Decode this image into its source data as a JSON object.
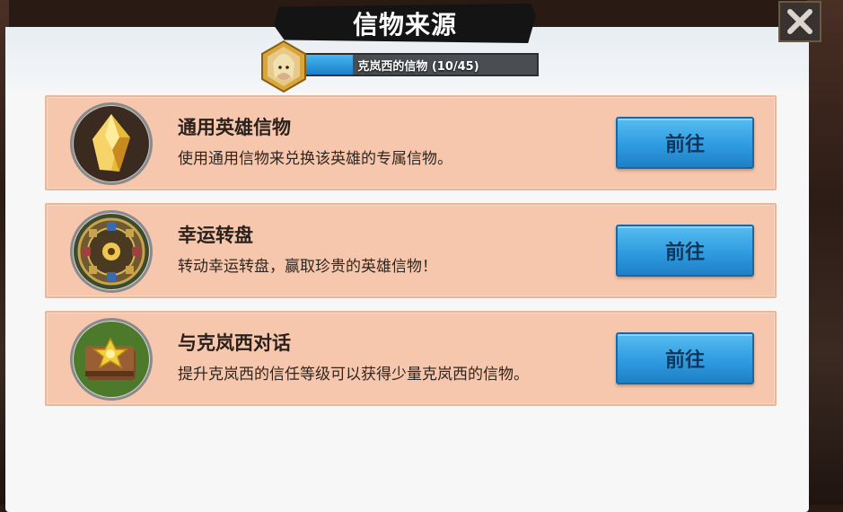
{
  "title": "信物来源",
  "progress": {
    "label": "克岚西的信物 (10/45)",
    "current": 10,
    "total": 45,
    "fraction": 0.2222
  },
  "sources": [
    {
      "icon": "golden-crystal-icon",
      "title": "通用英雄信物",
      "description": "使用通用信物来兑换该英雄的专属信物。",
      "button_label": "前往"
    },
    {
      "icon": "fortune-wheel-icon",
      "title": "幸运转盘",
      "description": "转动幸运转盘，赢取珍贵的英雄信物！",
      "button_label": "前往"
    },
    {
      "icon": "book-icon",
      "title": "与克岚西对话",
      "description": "提升克岚西的信任等级可以获得少量克岚西的信物。",
      "button_label": "前往"
    }
  ],
  "colors": {
    "card_bg": "#f6c7ac",
    "button_blue": "#2f9be0",
    "progress_fill": "#2c96dc",
    "banner": "#141414"
  }
}
